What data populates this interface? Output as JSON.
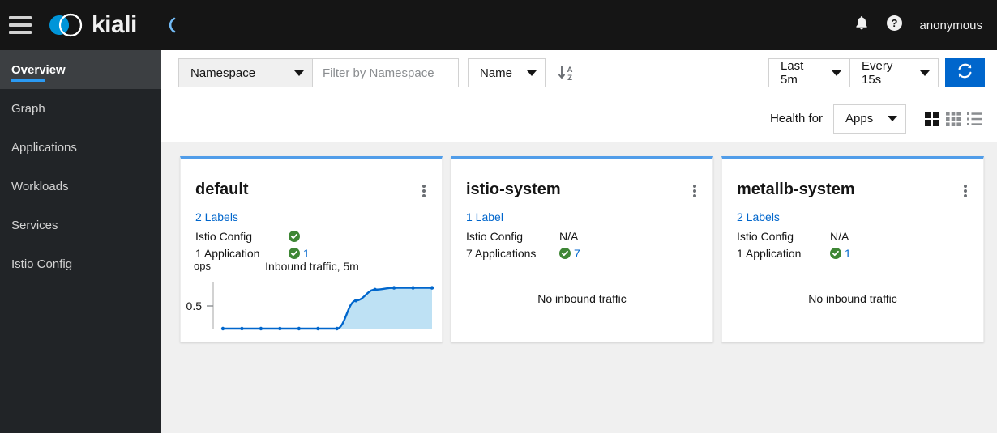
{
  "masthead": {
    "menu_icon": "hamburger-icon",
    "brand": "kiali",
    "logo_icon": "kiali-logo",
    "loading_icon": "spinner-arc",
    "notifications_icon": "bell-icon",
    "help_icon": "help-circle-icon",
    "username": "anonymous",
    "bg_color": "#151515"
  },
  "sidebar": {
    "bg_color": "#212427",
    "active_accent": "#2b9af3",
    "items": [
      {
        "label": "Overview",
        "active": true
      },
      {
        "label": "Graph",
        "active": false
      },
      {
        "label": "Applications",
        "active": false
      },
      {
        "label": "Workloads",
        "active": false
      },
      {
        "label": "Services",
        "active": false
      },
      {
        "label": "Istio Config",
        "active": false
      }
    ]
  },
  "toolbar": {
    "namespace_select": "Namespace",
    "filter_placeholder": "Filter by Namespace",
    "filter_value": "",
    "sort_field_select": "Name",
    "sort_direction_icon": "sort-alpha-down-icon",
    "time_range_select": "Last 5m",
    "refresh_interval_select": "Every 15s",
    "refresh_icon": "refresh-icon",
    "refresh_color": "#0066cc",
    "health_for_label": "Health for",
    "health_for_select": "Apps",
    "view_toggles": [
      {
        "icon": "grid-compact-icon",
        "selected": true
      },
      {
        "icon": "grid-expand-icon",
        "selected": false
      },
      {
        "icon": "list-view-icon",
        "selected": false
      }
    ]
  },
  "cards": [
    {
      "title": "default",
      "labels_link": "2 Labels",
      "istio_config_label": "Istio Config",
      "istio_config_status": "healthy",
      "istio_config_value": "",
      "apps_label": "1 Application",
      "apps_status": "healthy",
      "apps_count": "1",
      "has_chart": true,
      "no_traffic_text": ""
    },
    {
      "title": "istio-system",
      "labels_link": "1 Label",
      "istio_config_label": "Istio Config",
      "istio_config_status": "na",
      "istio_config_value": "N/A",
      "apps_label": "7 Applications",
      "apps_status": "healthy",
      "apps_count": "7",
      "has_chart": false,
      "no_traffic_text": "No inbound traffic"
    },
    {
      "title": "metallb-system",
      "labels_link": "2 Labels",
      "istio_config_label": "Istio Config",
      "istio_config_status": "na",
      "istio_config_value": "N/A",
      "apps_label": "1 Application",
      "apps_status": "healthy",
      "apps_count": "1",
      "has_chart": false,
      "no_traffic_text": "No inbound traffic"
    }
  ],
  "chart_data": {
    "type": "area",
    "title": "Inbound traffic, 5m",
    "xlabel": "",
    "ylabel": "ops",
    "ylim": [
      0,
      1.0
    ],
    "ytick_labels": [
      "0.5"
    ],
    "ytick_values": [
      0.5
    ],
    "grid": false,
    "legend": "none",
    "line_color": "#06c",
    "fill_color": "#bee1f4",
    "x": [
      0,
      1,
      2,
      3,
      4,
      5,
      6,
      7,
      8,
      9,
      10,
      11
    ],
    "series": [
      {
        "name": "Inbound traffic",
        "values": [
          0,
          0,
          0,
          0,
          0,
          0,
          0,
          0.62,
          0.86,
          0.9,
          0.9,
          0.9
        ]
      }
    ]
  },
  "colors": {
    "card_top_border": "#519de9",
    "healthy_green": "#3e8635",
    "link_blue": "#0066cc",
    "content_bg": "#f0f0f0"
  }
}
